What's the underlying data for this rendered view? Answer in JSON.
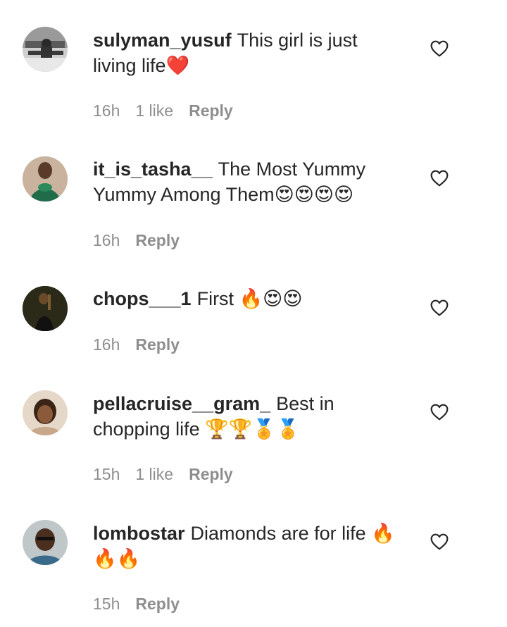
{
  "comments": [
    {
      "username": "sulyman_yusuf",
      "text": "This girl is just living life❤️",
      "time": "16h",
      "likes": "1 like",
      "reply": "Reply"
    },
    {
      "username": "it_is_tasha__",
      "text": "The Most Yummy Yummy Among Them😍😍😍😍",
      "time": "16h",
      "likes": "",
      "reply": "Reply"
    },
    {
      "username": "chops___1",
      "text": "First 🔥😍😍",
      "time": "16h",
      "likes": "",
      "reply": "Reply"
    },
    {
      "username": "pellacruise__gram_",
      "text": "Best in chopping life 🏆🏆🏅🏅",
      "time": "15h",
      "likes": "1 like",
      "reply": "Reply"
    },
    {
      "username": "lombostar",
      "text": "Diamonds are for life 🔥🔥🔥",
      "time": "15h",
      "likes": "",
      "reply": "Reply"
    }
  ],
  "icons": {
    "like": "heart-outline-icon"
  }
}
